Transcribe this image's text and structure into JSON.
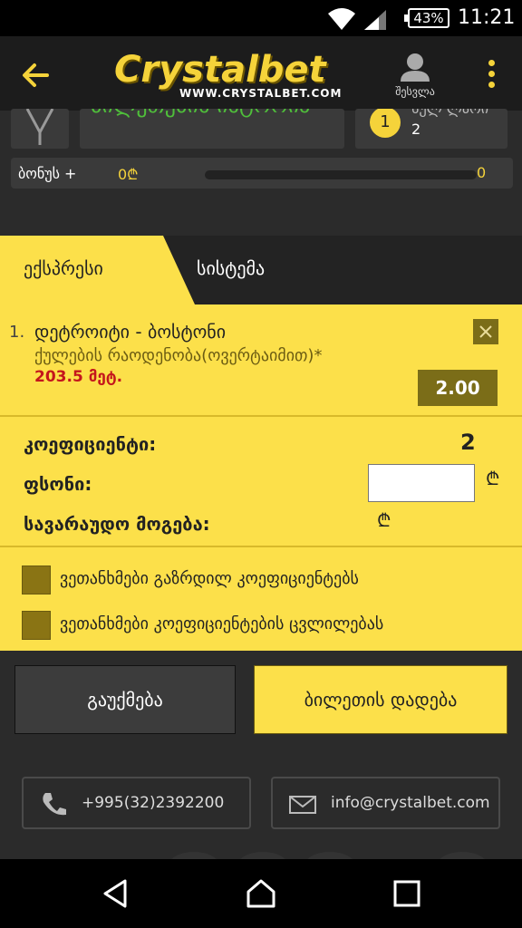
{
  "status_bar": {
    "battery": "43%",
    "time": "11:21"
  },
  "app_bar": {
    "back_icon": "arrow-left-icon",
    "logo_text": "Crystalbet",
    "logo_url": "WWW.CRYSTALBET.COM",
    "profile_label": "შესვლა",
    "menu_icon": "more-vert-icon"
  },
  "score_band": {
    "card2_text": "ბილეთების ისტორია",
    "card3_coin": "1",
    "card3_text": "სულ ლარი",
    "card3_value": "2",
    "bonus_label": "ბონუს +",
    "bonus_value": "0₾",
    "bonus_end": "0"
  },
  "tabs": [
    {
      "label": "ექსპრესი",
      "active": true
    },
    {
      "label": "სისტემა",
      "active": false
    }
  ],
  "bet": {
    "index": "1.",
    "match": "დეტროიტი - ბოსტონი",
    "market": "ქულების რაოდენობა(ოვერტაიმით)*",
    "selection": "203.5 მეტ.",
    "odds": "2.00"
  },
  "calc": {
    "coef_label": "კოეფიციენტი:",
    "coef_value": "2",
    "stake_label": "ფსონი:",
    "stake_value": "",
    "currency": "₾",
    "win_label": "სავარაუდო მოგება:",
    "win_currency": "₾"
  },
  "options": [
    {
      "label": "ვეთანხმები გაზრდილ კოეფიციენტებს",
      "checked": false
    },
    {
      "label": "ვეთანხმები კოეფიციენტების ცვლილებას",
      "checked": false
    }
  ],
  "actions": {
    "clear_label": "გაუქმება",
    "place_label": "ბილეთის დადება"
  },
  "footer": {
    "phone": "+995(32)2392200",
    "email": "info@crystalbet.com"
  },
  "colors": {
    "accent": "#fce04a",
    "dark": "#2b2b2b",
    "odds_bg": "#7b6d18",
    "selection_red": "#c4161c"
  }
}
